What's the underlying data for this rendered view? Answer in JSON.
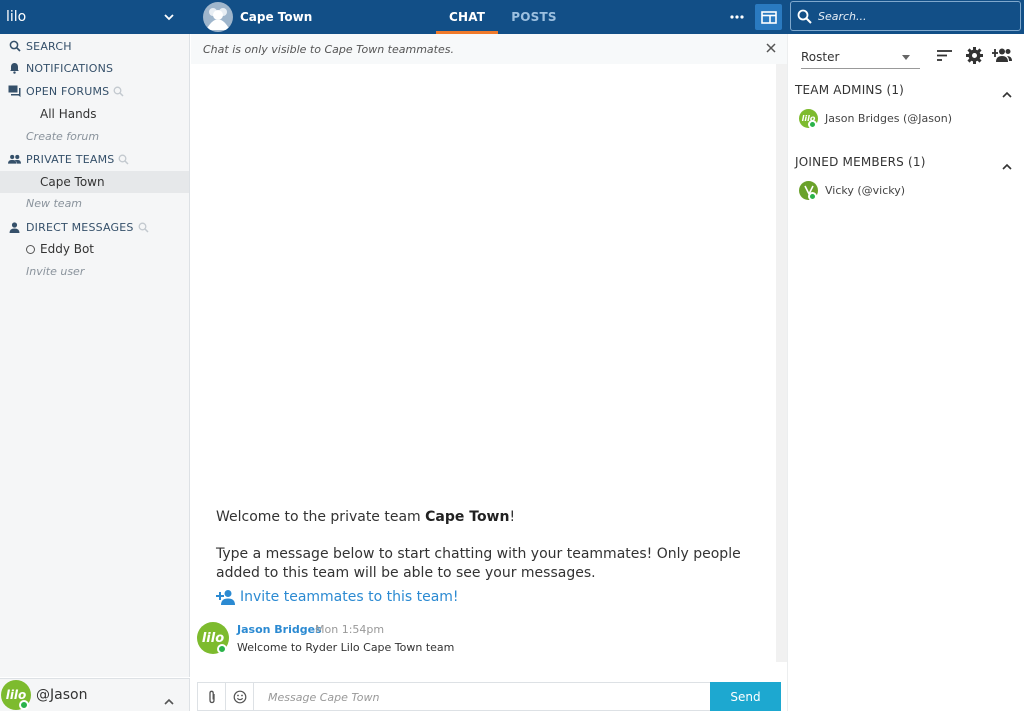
{
  "topbar": {
    "workspace": "lilo",
    "team_name": "Cape Town",
    "tabs": [
      "CHAT",
      "POSTS"
    ],
    "active_tab": "CHAT",
    "search_placeholder": "Search..."
  },
  "sidebar": {
    "search": "SEARCH",
    "notifications": "NOTIFICATIONS",
    "open_forums": "OPEN FORUMS",
    "forums": [
      "All Hands"
    ],
    "create_forum": "Create forum",
    "private_teams": "PRIVATE TEAMS",
    "teams": [
      "Cape Town"
    ],
    "new_team": "New team",
    "direct_messages": "DIRECT MESSAGES",
    "dms": [
      "Eddy Bot"
    ],
    "invite_user": "Invite user"
  },
  "user": {
    "handle": "@Jason",
    "avatar_text": "lilo"
  },
  "chat": {
    "notice": "Chat is only visible to Cape Town teammates.",
    "welcome_prefix": "Welcome to the private team ",
    "welcome_team": "Cape Town",
    "welcome_suffix": "!",
    "welcome_body": "Type a message below to start chatting with your teammates! Only people added to this team will be able to see your messages.",
    "invite_link": "Invite teammates to this team!",
    "messages": [
      {
        "author": "Jason Bridges",
        "time": "Mon 1:54pm",
        "text": "Welcome to Ryder Lilo Cape Town team"
      }
    ],
    "composer_placeholder": "Message Cape Town",
    "send_label": "Send"
  },
  "roster": {
    "select_value": "Roster",
    "groups": [
      {
        "title": "TEAM ADMINS (1)",
        "members": [
          "Jason Bridges (@Jason)"
        ]
      },
      {
        "title": "JOINED MEMBERS (1)",
        "members": [
          "Vicky (@vicky)"
        ]
      }
    ]
  },
  "colors": {
    "topbar": "#124f87",
    "active_tab_underline": "#f07a2a",
    "link": "#2b8ad2",
    "send_button": "#1da8d0",
    "online": "#2ab34a",
    "brand_avatar": "#7dbb2e"
  }
}
